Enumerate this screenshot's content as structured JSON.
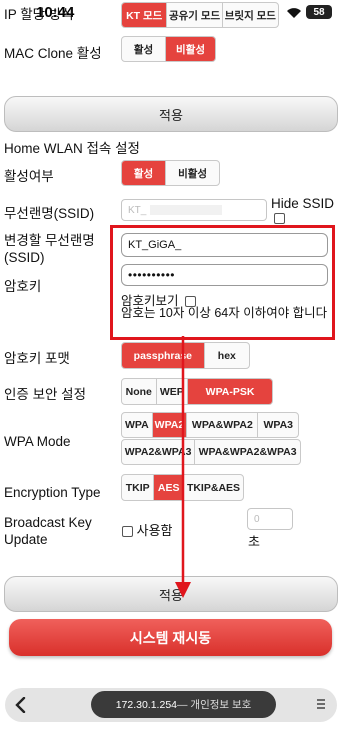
{
  "status_bar": {
    "time": "10:44",
    "battery": "58"
  },
  "ip_share": {
    "label": "IP 할당 방식",
    "options": [
      "KT 모드",
      "공유기 모드",
      "브릿지 모드"
    ],
    "selected": "KT 모드"
  },
  "mac_clone": {
    "label": "MAC Clone 활성",
    "options": [
      "활성",
      "비활성"
    ],
    "selected": "비활성"
  },
  "apply_top_label": "적용",
  "section_title": "Home WLAN 접속 설정",
  "enable": {
    "label": "활성여부",
    "options": [
      "활성",
      "비활성"
    ],
    "selected": "활성"
  },
  "ssid": {
    "label": "무선랜명(SSID)",
    "value": "KT_",
    "hide_label": "Hide SSID"
  },
  "new_ssid": {
    "label": "변경할 무선랜명 (SSID)",
    "value": "KT_GiGA_"
  },
  "password": {
    "label": "암호키",
    "value": "••••••••••",
    "show_label": "암호키보기",
    "note": "암호는 10자 이상 64자 이하여야 합니다"
  },
  "key_format": {
    "label": "암호키 포맷",
    "options": [
      "passphrase",
      "hex"
    ],
    "selected": "passphrase"
  },
  "auth": {
    "label": "인증 보안 설정",
    "options": [
      "None",
      "WEP",
      "WPA-PSK"
    ],
    "selected": "WPA-PSK"
  },
  "wpa_mode": {
    "label": "WPA Mode",
    "row1": [
      "WPA",
      "WPA2",
      "WPA&WPA2",
      "WPA3"
    ],
    "row2": [
      "WPA2&WPA3",
      "WPA&WPA2&WPA3"
    ],
    "selected": "WPA2"
  },
  "encryption": {
    "label": "Encryption Type",
    "options": [
      "TKIP",
      "AES",
      "TKIP&AES"
    ],
    "selected": "AES"
  },
  "broadcast": {
    "label": "Broadcast Key Update",
    "use_label": "사용함",
    "value": "0",
    "unit": "초"
  },
  "apply_bottom_label": "적용",
  "restart_label": "시스템 재시동",
  "browser": {
    "url": "172.30.1.254",
    "suffix": " — 개인정보 보호"
  },
  "colors": {
    "accent": "#e5433e",
    "highlight_box": "#e0161d"
  }
}
